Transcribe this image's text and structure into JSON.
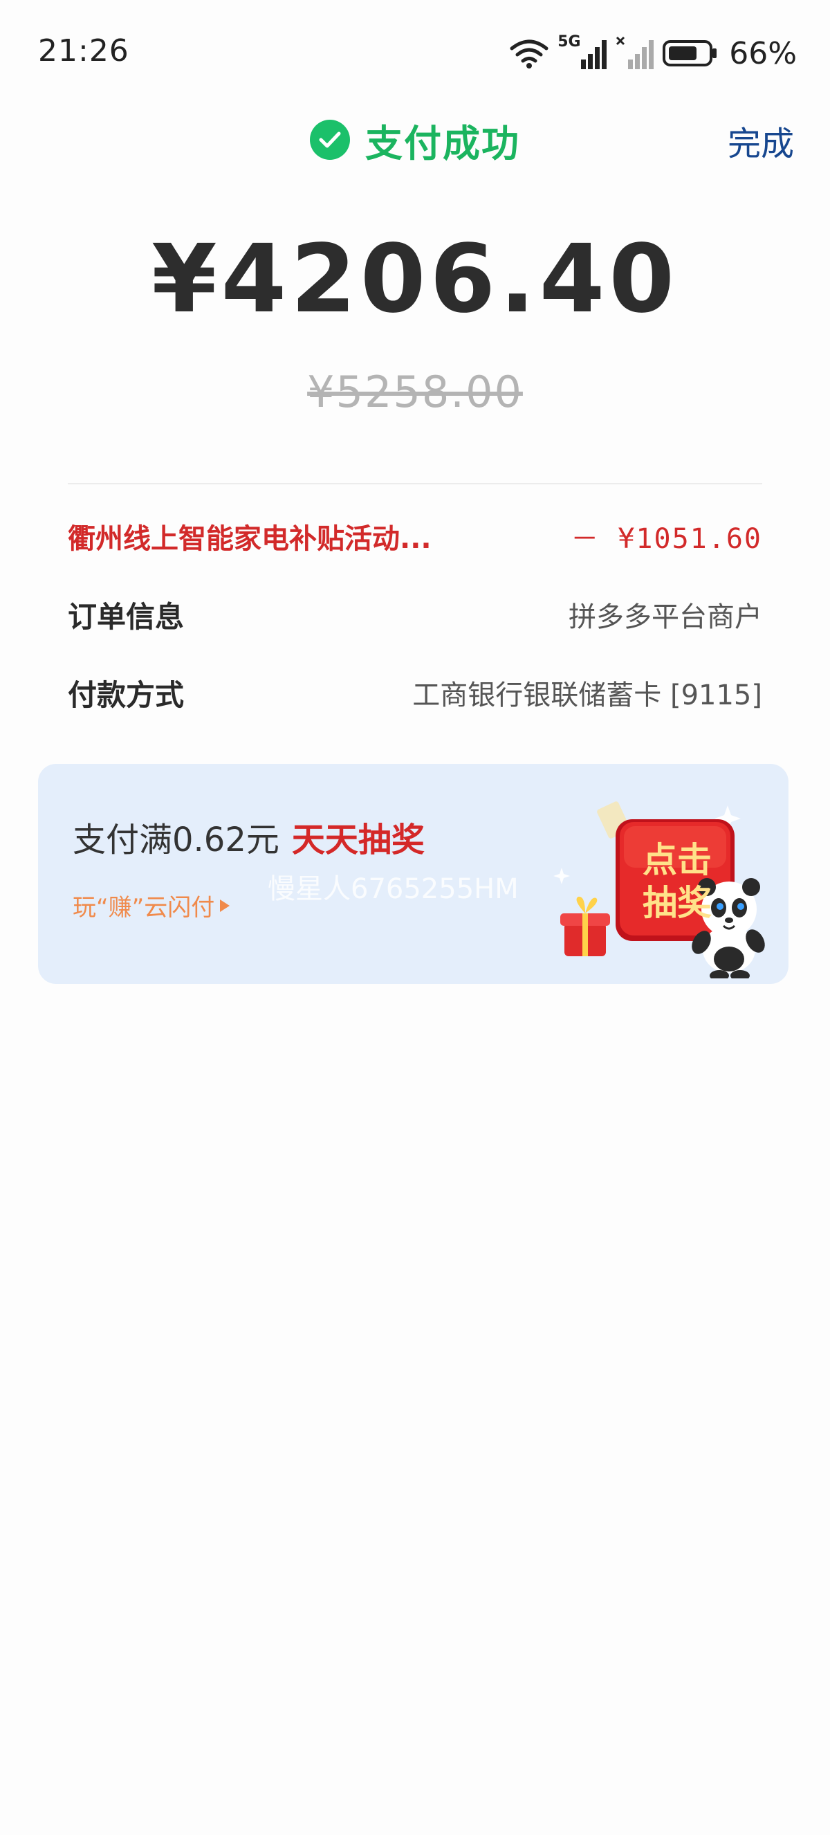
{
  "status_bar": {
    "time": "21:26",
    "network": "5G",
    "battery": "66%"
  },
  "header": {
    "title": "支付成功",
    "done_label": "完成"
  },
  "payment": {
    "amount": "¥4206.40",
    "original_amount": "¥5258.00"
  },
  "details": {
    "subsidy_label": "衢州线上智能家电补贴活动...",
    "subsidy_value": "－ ¥1051.60",
    "order_label": "订单信息",
    "order_value": "拼多多平台商户",
    "payment_label": "付款方式",
    "payment_value": "工商银行银联储蓄卡 [9115]"
  },
  "promo": {
    "prefix": "支付满0.62元",
    "highlight": "天天抽奖",
    "link_label": "玩“赚”云闪付",
    "watermark": "慢星人6765255HM",
    "button_line1": "点击",
    "button_line2": "抽奖"
  },
  "colors": {
    "success_green": "#1bc06a",
    "done_blue": "#17478f",
    "subsidy_red": "#d22a2a",
    "promo_bg": "#e4eefb",
    "promo_link_orange": "#f08a4b"
  }
}
